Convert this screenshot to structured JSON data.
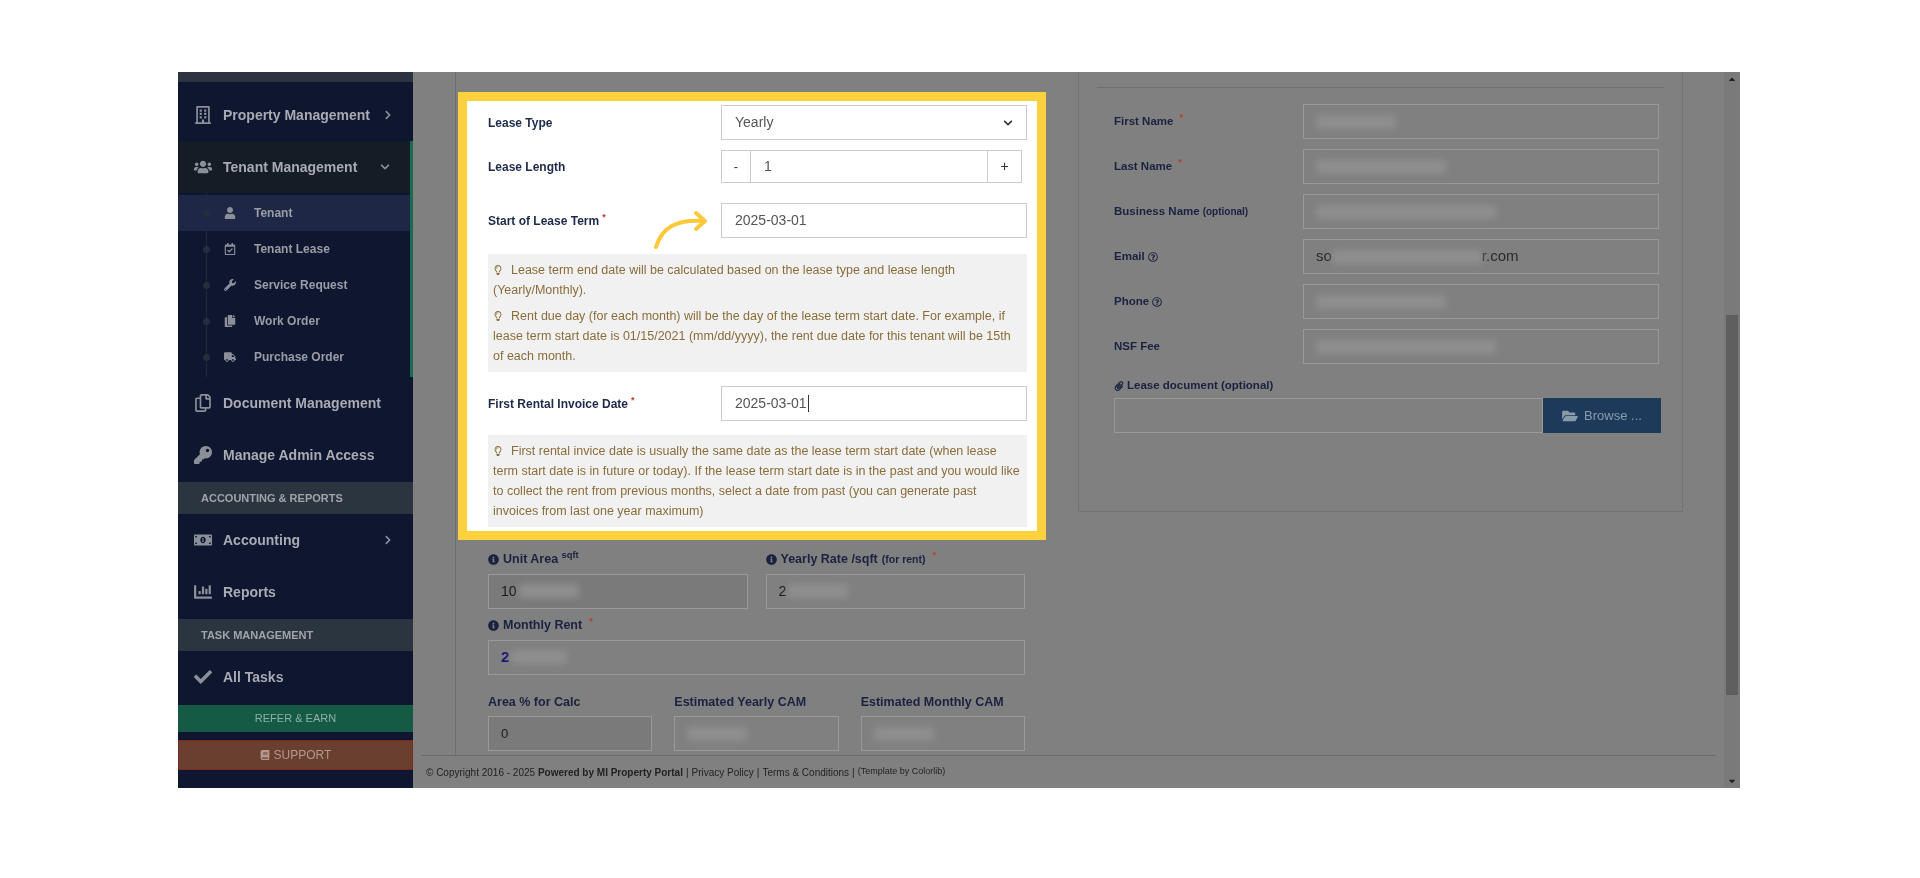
{
  "sidebar": [
    {
      "kind": "menu",
      "label": "Property Management",
      "caret": true,
      "expanded": false,
      "selected": false
    },
    {
      "kind": "menu",
      "label": "Tenant Management",
      "caret": true,
      "expanded": true,
      "selected": true,
      "children": [
        {
          "label": "Tenant",
          "selected": true
        },
        {
          "label": "Tenant Lease",
          "selected": false
        },
        {
          "label": "Service Request",
          "selected": false
        },
        {
          "label": "Work Order",
          "selected": false
        },
        {
          "label": "Purchase Order",
          "selected": false
        }
      ]
    },
    {
      "kind": "menu",
      "label": "Document Management",
      "caret": false,
      "selected": false
    },
    {
      "kind": "menu",
      "label": "Manage Admin Access",
      "caret": false,
      "selected": false
    },
    {
      "kind": "header",
      "label": "ACCOUNTING & REPORTS"
    },
    {
      "kind": "menu",
      "label": "Accounting",
      "caret": true,
      "expanded": false,
      "selected": false
    },
    {
      "kind": "menu",
      "label": "Reports",
      "caret": false,
      "selected": false
    },
    {
      "kind": "header",
      "label": "TASK MANAGEMENT"
    },
    {
      "kind": "menu",
      "label": "All Tasks",
      "caret": false,
      "selected": false
    },
    {
      "kind": "refer",
      "label": "REFER & EARN"
    },
    {
      "kind": "support",
      "label": "SUPPORT"
    }
  ],
  "lease_form": {
    "lease_type": {
      "label": "Lease Type",
      "value": "Yearly"
    },
    "lease_length": {
      "label": "Lease Length",
      "value": "1",
      "minus": "-",
      "plus": "+"
    },
    "start": {
      "label": "Start of Lease Term",
      "mark": "*",
      "value": "2025-03-01"
    },
    "start_notes": [
      "Lease term end date will be calculated based on the lease type and lease length (Yearly/Monthly).",
      "Rent due day (for each month) will be the day of the lease term start date. For example, if lease term start date is 01/15/2021 (mm/dd/yyyy), the rent due date for this tenant will be 15th of each month."
    ],
    "invoice": {
      "label": "First Rental Invoice Date",
      "mark": "*",
      "value": "2025-03-01"
    },
    "invoice_notes": [
      "First rental invice date is usually the same date as the lease term start date (when lease term start date is in future or today). If the lease term start date is in the past and you would like to collect the rent from previous months, select a date from past (you can generate past invoices from last one year maximum)"
    ]
  },
  "rent": {
    "unit_area": {
      "label": "Unit Area $^{sqft}$",
      "value": "10"
    },
    "yearly_rate": {
      "label": "Yearly Rate /sqft",
      "suffix": "(for rent)",
      "mark": "*",
      "value": "2"
    },
    "monthly_rent": {
      "label": "Monthly Rent",
      "mark": "*",
      "value": "2"
    },
    "cam": [
      {
        "label": "Area % for Calc",
        "value": "0"
      },
      {
        "label": "Estimated Yearly CAM"
      },
      {
        "label": "Estimated Monthly CAM"
      }
    ]
  },
  "tenant": {
    "fields": [
      {
        "label": "First Name",
        "mark": "*",
        "help": false
      },
      {
        "label": "Last Name",
        "mark": "*",
        "help": false
      },
      {
        "label": "Business Name",
        "suffix": "(optional)",
        "help": false
      },
      {
        "label": "Email",
        "help": true,
        "value_start": "so",
        "value_end": "r.com"
      },
      {
        "label": "Phone",
        "help": true
      },
      {
        "label": "NSF Fee",
        "help": false
      }
    ],
    "document": {
      "label": "Lease document (optional)",
      "button": "Browse ..."
    }
  },
  "footer": {
    "copyright": "© Copyright 2016 - 2025 **Powered by MI Property Portal**",
    "separator": "|",
    "links": [
      "Privacy Policy",
      "Terms & Conditions"
    ],
    "credit": "(Template by Colorlib)"
  }
}
